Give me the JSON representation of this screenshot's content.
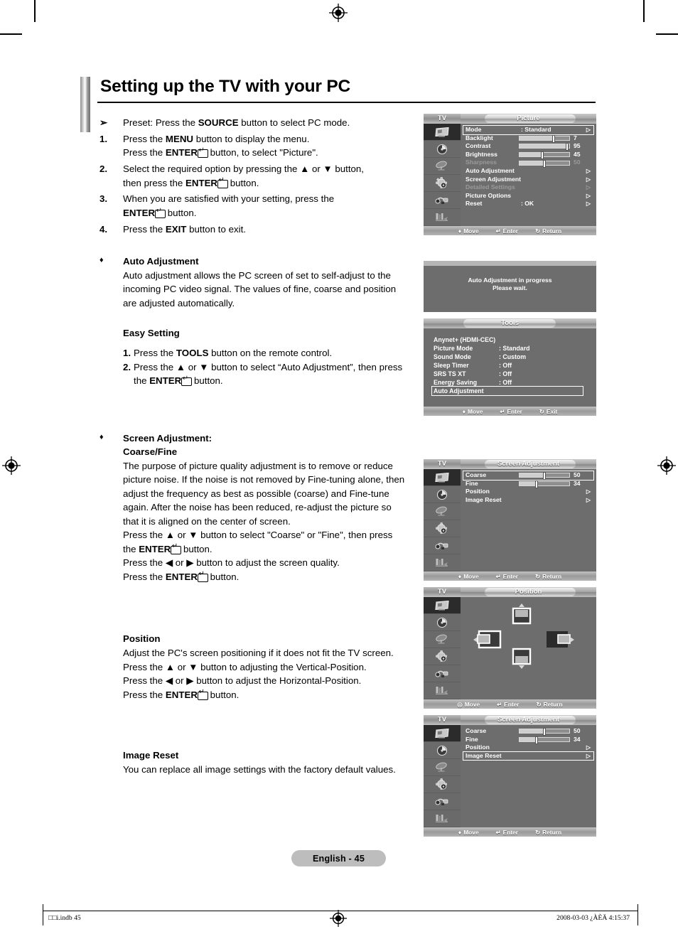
{
  "document": {
    "title": "Setting up the TV with your PC",
    "page_badge": "English - 45",
    "footer_left": "□□i.indb   45",
    "footer_right": "2008-03-03   ¿ÀÈÄ 4:15:37"
  },
  "steps": [
    {
      "marker": "➢",
      "html": "Preset: Press the <b>SOURCE</b> button to select PC mode."
    },
    {
      "marker": "1.",
      "html": "Press the <b>MENU</b> button to display the menu.<br>Press the <b>ENTER</b><span class=\"enter-glyph\"></span> button, to select \"Picture\"."
    },
    {
      "marker": "2.",
      "html": "Select the required option by pressing the ▲ or ▼ button,<br>then press the <b>ENTER</b><span class=\"enter-glyph\"></span> button."
    },
    {
      "marker": "3.",
      "html": "When you are satisfied with your setting, press the<br><b>ENTER</b><span class=\"enter-glyph\"></span> button."
    },
    {
      "marker": "4.",
      "html": "Press the <b>EXIT</b> button to exit."
    }
  ],
  "sections": {
    "auto_adjustment": {
      "bullet": "♦",
      "heading": "Auto Adjustment",
      "body": "Auto adjustment allows the PC screen of set to self-adjust to the incoming PC video signal. The values of fine, coarse and position are adjusted automatically.",
      "easy_setting_heading": "Easy Setting",
      "easy_steps": [
        {
          "n": "1.",
          "html": "Press the <b>TOOLS</b> button on the remote control."
        },
        {
          "n": "2.",
          "html": "Press the ▲ or ▼ button to select “Auto Adjustment”, then press the <b>ENTER</b><span class=\"enter-glyph\"></span> button."
        }
      ]
    },
    "screen_adjustment": {
      "bullet": "♦",
      "heading_line1": "Screen Adjustment:",
      "heading_line2": "Coarse/Fine",
      "body": "The purpose of picture quality adjustment is to remove or reduce picture noise. If the noise is not removed by Fine-tuning alone, then adjust the frequency as best as possible (coarse) and Fine-tune again. After the noise has been reduced, re-adjust the picture so that it is aligned on the center of screen.",
      "instructions": [
        "Press the ▲ or ▼ button to select \"Coarse\" or \"Fine\", then press the <b>ENTER</b><span class=\"enter-glyph\"></span> button.",
        "Press the ◀ or ▶ button to adjust the screen quality.",
        "Press the <b>ENTER</b><span class=\"enter-glyph\"></span> button."
      ]
    },
    "position": {
      "heading": "Position",
      "body": "Adjust the PC's screen positioning if it does not fit the TV screen.",
      "instructions": [
        "Press the ▲ or ▼ button to adjusting the Vertical-Position.",
        "Press the ◀ or ▶ button to adjust the Horizontal-Position.",
        "Press the <b>ENTER</b><span class=\"enter-glyph\"></span> button."
      ]
    },
    "image_reset": {
      "heading": "Image Reset",
      "body": "You can replace all image settings with the factory default values."
    }
  },
  "osd": {
    "tv_label": "TV",
    "nav": {
      "move": "Move",
      "enter": "Enter",
      "return": "Return",
      "exit": "Exit"
    },
    "picture_menu": {
      "title": "Picture",
      "rows": [
        {
          "label": "Mode",
          "value": ": Standard",
          "type": "value",
          "selected": true,
          "dim": false,
          "arrow": true
        },
        {
          "label": "Backlight",
          "value": "7",
          "type": "slider",
          "pct": 68,
          "dim": false
        },
        {
          "label": "Contrast",
          "value": "95",
          "type": "slider",
          "pct": 95,
          "dim": false
        },
        {
          "label": "Brightness",
          "value": "45",
          "type": "slider",
          "pct": 45,
          "dim": false
        },
        {
          "label": "Sharpness",
          "value": "50",
          "type": "slider",
          "pct": 50,
          "dim": true
        },
        {
          "label": "Auto Adjustment",
          "value": "",
          "type": "arrow",
          "dim": false
        },
        {
          "label": "Screen Adjustment",
          "value": "",
          "type": "arrow",
          "dim": false
        },
        {
          "label": "Detailed Settings",
          "value": "",
          "type": "arrow",
          "dim": true
        },
        {
          "label": "Picture Options",
          "value": "",
          "type": "arrow",
          "dim": false
        },
        {
          "label": "Reset",
          "value": ": OK",
          "type": "value",
          "dim": false,
          "arrow": true
        }
      ]
    },
    "wait_popup": {
      "line1": "Auto Adjustment in progress",
      "line2": "Please wait."
    },
    "tools_menu": {
      "title": "Tools",
      "rows": [
        {
          "label": "Anynet+ (HDMI-CEC)",
          "value": "",
          "selected": false
        },
        {
          "label": "Picture Mode",
          "value": ": Standard",
          "selected": false
        },
        {
          "label": "Sound Mode",
          "value": ": Custom",
          "selected": false
        },
        {
          "label": "Sleep Timer",
          "value": ": Off",
          "selected": false
        },
        {
          "label": "SRS TS XT",
          "value": ": Off",
          "selected": false
        },
        {
          "label": "Energy Saving",
          "value": ": Off",
          "selected": false
        },
        {
          "label": "Auto Adjustment",
          "value": "",
          "selected": true
        }
      ]
    },
    "screen_adjustment_menu": {
      "title": "Screen Adjustment",
      "rows": [
        {
          "label": "Coarse",
          "value": "50",
          "type": "slider",
          "pct": 50,
          "selected": true
        },
        {
          "label": "Fine",
          "value": "34",
          "type": "slider",
          "pct": 34,
          "selected": false
        },
        {
          "label": "Position",
          "value": "",
          "type": "arrow",
          "selected": false
        },
        {
          "label": "Image Reset",
          "value": "",
          "type": "arrow",
          "selected": false
        }
      ]
    },
    "position_menu": {
      "title": "Position",
      "nav_move": "Move"
    },
    "screen_adjustment_menu2": {
      "title": "Screen Adjustment",
      "rows": [
        {
          "label": "Coarse",
          "value": "50",
          "type": "slider",
          "pct": 50,
          "selected": false
        },
        {
          "label": "Fine",
          "value": "34",
          "type": "slider",
          "pct": 34,
          "selected": false
        },
        {
          "label": "Position",
          "value": "",
          "type": "arrow",
          "selected": false
        },
        {
          "label": "Image Reset",
          "value": "",
          "type": "arrow",
          "selected": true
        }
      ]
    }
  }
}
